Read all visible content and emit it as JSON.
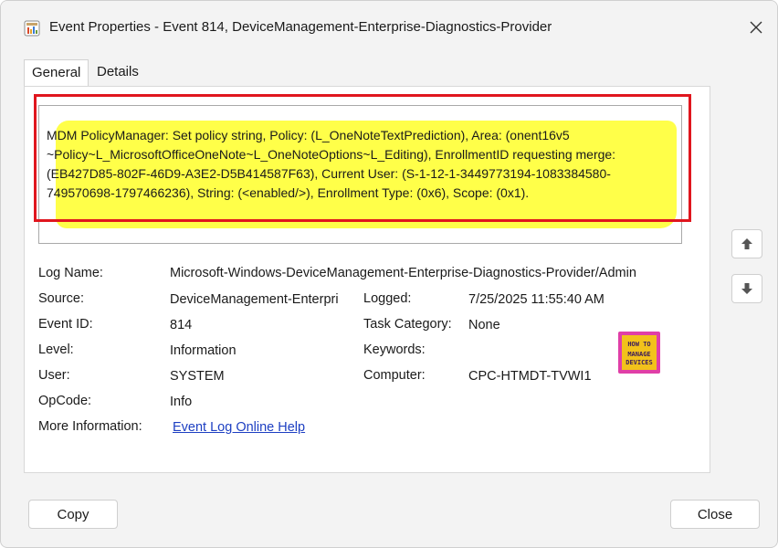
{
  "window": {
    "title": "Event Properties - Event 814, DeviceManagement-Enterprise-Diagnostics-Provider"
  },
  "tabs": [
    {
      "label": "General"
    },
    {
      "label": "Details"
    }
  ],
  "description": {
    "text": "MDM PolicyManager: Set policy string, Policy: (L_OneNoteTextPrediction), Area: (onent16v5 ~Policy~L_MicrosoftOfficeOneNote~L_OneNoteOptions~L_Editing), EnrollmentID requesting merge: (EB427D85-802F-46D9-A3E2-D5B414587F63), Current User: (S-1-12-1-3449773194-1083384580-749570698-1797466236), String: (<enabled/>), Enrollment Type: (0x6), Scope: (0x1)."
  },
  "fields": {
    "log_name_label": "Log Name:",
    "log_name_value": "Microsoft-Windows-DeviceManagement-Enterprise-Diagnostics-Provider/Admin",
    "source_label": "Source:",
    "source_value": "DeviceManagement-Enterpri",
    "logged_label": "Logged:",
    "logged_value": "7/25/2025 11:55:40 AM",
    "event_id_label": "Event ID:",
    "event_id_value": "814",
    "task_category_label": "Task Category:",
    "task_category_value": "None",
    "level_label": "Level:",
    "level_value": "Information",
    "keywords_label": "Keywords:",
    "keywords_value": "",
    "user_label": "User:",
    "user_value": "SYSTEM",
    "computer_label": "Computer:",
    "computer_value": "CPC-HTMDT-TVWI1",
    "opcode_label": "OpCode:",
    "opcode_value": "Info",
    "more_info_label": "More Information:",
    "more_info_link": "Event Log Online Help"
  },
  "logo": {
    "line1": "HOW TO",
    "line2": "MANAGE",
    "line3": "DEVICES"
  },
  "buttons": {
    "copy": "Copy",
    "close": "Close"
  },
  "colors": {
    "highlight": "#ffff3a",
    "frame": "#e0161e",
    "link": "#1d3fc2"
  }
}
